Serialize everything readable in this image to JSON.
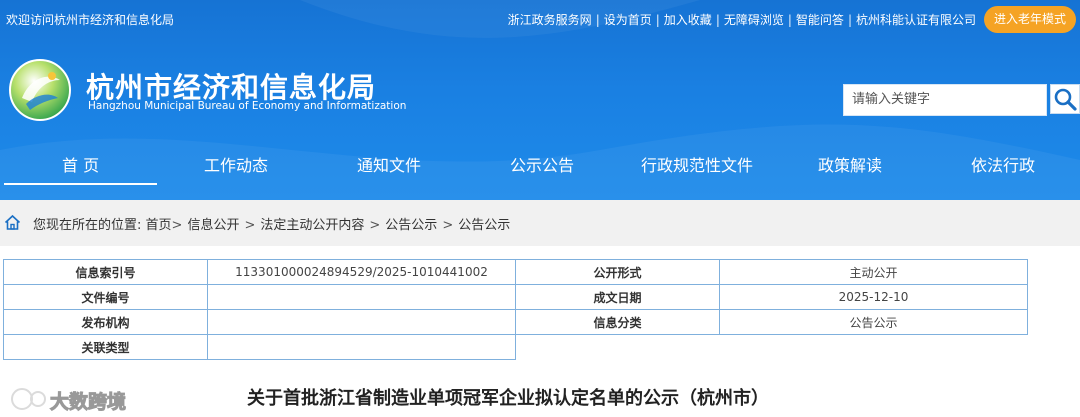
{
  "topbar": {
    "welcome": "欢迎访问杭州市经济和信息化局",
    "links": [
      "浙江政务服务网",
      "设为首页",
      "加入收藏",
      "无障碍浏览",
      "智能问答",
      "杭州科能认证有限公司"
    ],
    "separator": "|",
    "elder_mode": "进入老年模式"
  },
  "brand": {
    "title": "杭州市经济和信息化局",
    "subtitle": "Hangzhou Municipal Bureau of Economy and Informatization"
  },
  "search": {
    "placeholder": "请输入关键字"
  },
  "nav": {
    "items": [
      "首 页",
      "工作动态",
      "通知文件",
      "公示公告",
      "行政规范性文件",
      "政策解读",
      "依法行政"
    ],
    "active": "首 页"
  },
  "breadcrumb": {
    "prefix": "您现在所在的位置:",
    "items": [
      "首页",
      "信息公开",
      "法定主动公开内容",
      "公告公示",
      "公告公示"
    ],
    "separator": ">"
  },
  "info": {
    "index_label": "信息索引号",
    "index_value": "113301000024894529/2025-1010441002",
    "open_form_label": "公开形式",
    "open_form_value": "主动公开",
    "doc_no_label": "文件编号",
    "doc_no_value": "",
    "date_label": "成文日期",
    "date_value": "2025-12-10",
    "publisher_label": "发布机构",
    "publisher_value": "",
    "category_label": "信息分类",
    "category_value": "公告公示",
    "related_label": "关联类型",
    "related_value": ""
  },
  "article": {
    "title": "关于首批浙江省制造业单项冠军企业拟认定名单的公示（杭州市）"
  },
  "watermark": {
    "text": "大数跨境"
  },
  "colors": {
    "header": "#1a80e2",
    "accent": "#f5a324",
    "table_border": "#7fb0dd"
  }
}
